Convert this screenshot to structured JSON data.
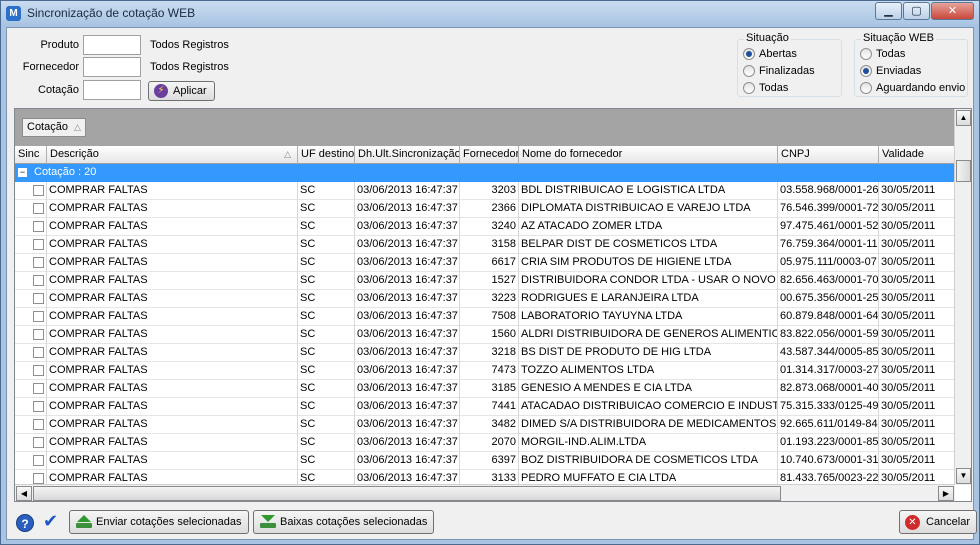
{
  "window": {
    "title": "Sincronização de cotação WEB",
    "app_icon_glyph": "M",
    "minimize_glyph": "▁",
    "maximize_glyph": "▢",
    "close_glyph": "✕"
  },
  "filters": {
    "produto": {
      "label": "Produto",
      "value": "",
      "info": "Todos Registros"
    },
    "fornecedor": {
      "label": "Fornecedor",
      "value": "",
      "info": "Todos Registros"
    },
    "cotacao": {
      "label": "Cotação",
      "value": ""
    },
    "apply_label": "Aplicar"
  },
  "situacao": {
    "title": "Situação",
    "options": [
      "Abertas",
      "Finalizadas",
      "Todas"
    ],
    "selected": "Abertas"
  },
  "situacao_web": {
    "title": "Situação WEB",
    "options": [
      "Todas",
      "Enviadas",
      "Aguardando envio"
    ],
    "selected": "Enviadas"
  },
  "grid": {
    "group_chip": "Cotação",
    "columns": [
      "Sinc",
      "Descrição",
      "UF destino",
      "Dh.Ult.Sincronização",
      "Fornecedor",
      "Nome do fornecedor",
      "CNPJ",
      "Validade"
    ],
    "group_row": "Cotação : 20",
    "rows": [
      {
        "descricao": "COMPRAR FALTAS",
        "uf": "SC",
        "dh": "03/06/2013 16:47:37",
        "fornecedor": "3203",
        "nome": "BDL DISTRIBUICAO E LOGISTICA LTDA",
        "cnpj": "03.558.968/0001-26",
        "validade": "30/05/2011"
      },
      {
        "descricao": "COMPRAR FALTAS",
        "uf": "SC",
        "dh": "03/06/2013 16:47:37",
        "fornecedor": "2366",
        "nome": "DIPLOMATA DISTRIBUICAO E VAREJO LTDA",
        "cnpj": "76.546.399/0001-72",
        "validade": "30/05/2011"
      },
      {
        "descricao": "COMPRAR FALTAS",
        "uf": "SC",
        "dh": "03/06/2013 16:47:37",
        "fornecedor": "3240",
        "nome": "AZ ATACADO ZOMER LTDA",
        "cnpj": "97.475.461/0001-52",
        "validade": "30/05/2011"
      },
      {
        "descricao": "COMPRAR FALTAS",
        "uf": "SC",
        "dh": "03/06/2013 16:47:37",
        "fornecedor": "3158",
        "nome": "BELPAR DIST DE COSMETICOS LTDA",
        "cnpj": "76.759.364/0001-11",
        "validade": "30/05/2011"
      },
      {
        "descricao": "COMPRAR FALTAS",
        "uf": "SC",
        "dh": "03/06/2013 16:47:37",
        "fornecedor": "6617",
        "nome": "CRIA SIM PRODUTOS DE HIGIENE LTDA",
        "cnpj": "05.975.111/0003-07",
        "validade": "30/05/2011"
      },
      {
        "descricao": "COMPRAR FALTAS",
        "uf": "SC",
        "dh": "03/06/2013 16:47:37",
        "fornecedor": "1527",
        "nome": "DISTRIBUIDORA CONDOR LTDA - USAR O NOVO",
        "cnpj": "82.656.463/0001-70",
        "validade": "30/05/2011"
      },
      {
        "descricao": "COMPRAR FALTAS",
        "uf": "SC",
        "dh": "03/06/2013 16:47:37",
        "fornecedor": "3223",
        "nome": "RODRIGUES E LARANJEIRA LTDA",
        "cnpj": "00.675.356/0001-25",
        "validade": "30/05/2011"
      },
      {
        "descricao": "COMPRAR FALTAS",
        "uf": "SC",
        "dh": "03/06/2013 16:47:37",
        "fornecedor": "7508",
        "nome": "LABORATORIO TAYUYNA LTDA",
        "cnpj": "60.879.848/0001-64",
        "validade": "30/05/2011"
      },
      {
        "descricao": "COMPRAR FALTAS",
        "uf": "SC",
        "dh": "03/06/2013 16:47:37",
        "fornecedor": "1560",
        "nome": "ALDRI DISTRIBUIDORA DE GENEROS ALIMENTIC",
        "cnpj": "83.822.056/0001-59",
        "validade": "30/05/2011"
      },
      {
        "descricao": "COMPRAR FALTAS",
        "uf": "SC",
        "dh": "03/06/2013 16:47:37",
        "fornecedor": "3218",
        "nome": "BS DIST DE PRODUTO DE HIG LTDA",
        "cnpj": "43.587.344/0005-85",
        "validade": "30/05/2011"
      },
      {
        "descricao": "COMPRAR FALTAS",
        "uf": "SC",
        "dh": "03/06/2013 16:47:37",
        "fornecedor": "7473",
        "nome": "TOZZO ALIMENTOS LTDA",
        "cnpj": "01.314.317/0003-27",
        "validade": "30/05/2011"
      },
      {
        "descricao": "COMPRAR FALTAS",
        "uf": "SC",
        "dh": "03/06/2013 16:47:37",
        "fornecedor": "3185",
        "nome": "GENESIO A MENDES E CIA LTDA",
        "cnpj": "82.873.068/0001-40",
        "validade": "30/05/2011"
      },
      {
        "descricao": "COMPRAR FALTAS",
        "uf": "SC",
        "dh": "03/06/2013 16:47:37",
        "fornecedor": "7441",
        "nome": "ATACADAO DISTRIBUICAO COMERCIO E INDUSTR",
        "cnpj": "75.315.333/0125-49",
        "validade": "30/05/2011"
      },
      {
        "descricao": "COMPRAR FALTAS",
        "uf": "SC",
        "dh": "03/06/2013 16:47:37",
        "fornecedor": "3482",
        "nome": "DIMED S/A DISTRIBUIDORA DE MEDICAMENTOS",
        "cnpj": "92.665.611/0149-84",
        "validade": "30/05/2011"
      },
      {
        "descricao": "COMPRAR FALTAS",
        "uf": "SC",
        "dh": "03/06/2013 16:47:37",
        "fornecedor": "2070",
        "nome": "MORGIL-IND.ALIM.LTDA",
        "cnpj": "01.193.223/0001-85",
        "validade": "30/05/2011"
      },
      {
        "descricao": "COMPRAR FALTAS",
        "uf": "SC",
        "dh": "03/06/2013 16:47:37",
        "fornecedor": "6397",
        "nome": "BOZ DISTRIBUIDORA DE COSMETICOS LTDA",
        "cnpj": "10.740.673/0001-31",
        "validade": "30/05/2011"
      },
      {
        "descricao": "COMPRAR FALTAS",
        "uf": "SC",
        "dh": "03/06/2013 16:47:37",
        "fornecedor": "3133",
        "nome": "PEDRO MUFFATO E CIA LTDA",
        "cnpj": "81.433.765/0023-22",
        "validade": "30/05/2011"
      }
    ]
  },
  "footer": {
    "help_glyph": "?",
    "check_glyph": "✔",
    "send_label": "Enviar cotações selecionadas",
    "download_label": "Baixas cotações selecionadas",
    "cancel_label": "Cancelar",
    "cancel_glyph": "✕"
  },
  "colors": {
    "group_row_bg": "#3399ff",
    "title_gradient_top": "#c9dcf0",
    "accent": "#1f4f9c"
  }
}
